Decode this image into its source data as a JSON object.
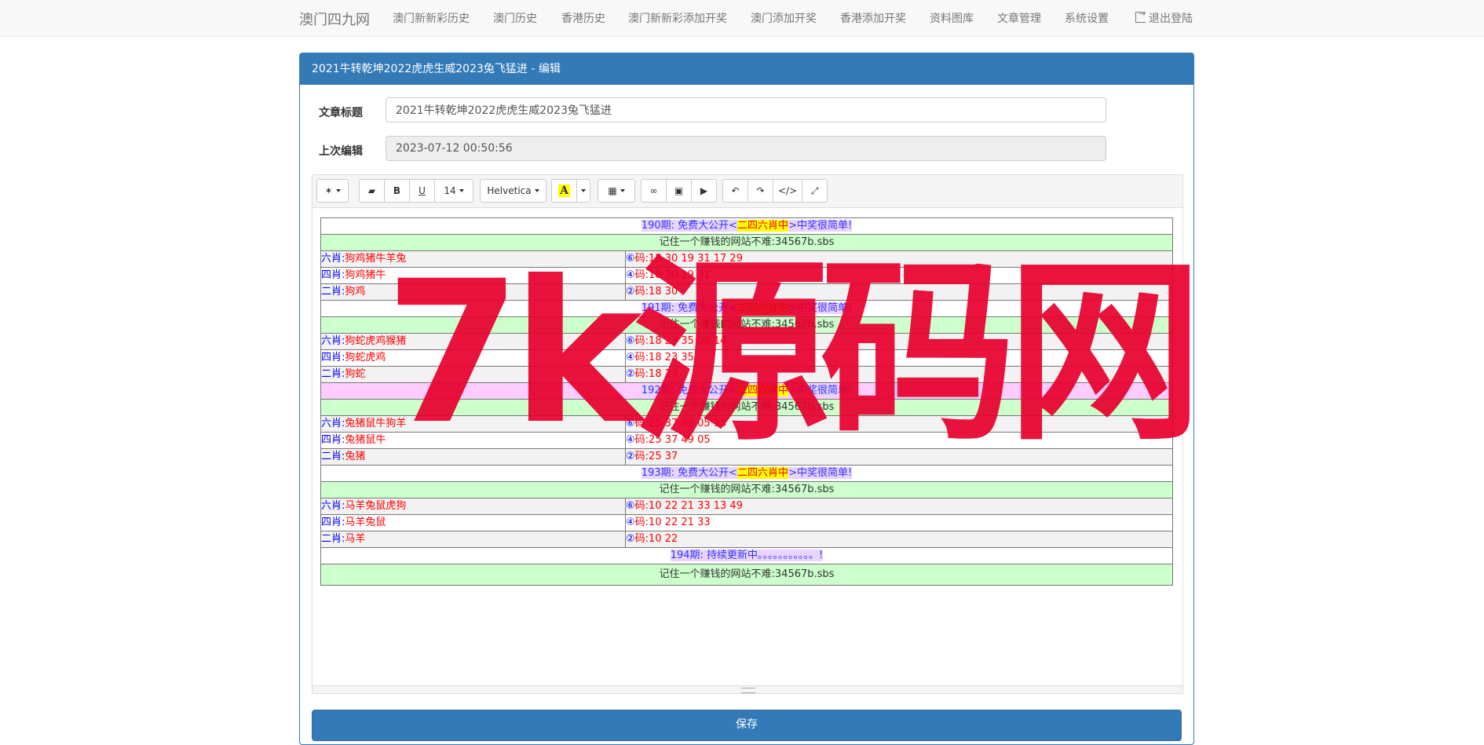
{
  "nav": {
    "brand": "澳门四九网",
    "links": [
      "澳门新新彩历史",
      "澳门历史",
      "香港历史",
      "澳门新新彩添加开奖",
      "澳门添加开奖",
      "香港添加开奖",
      "资料图库",
      "文章管理",
      "系统设置"
    ],
    "logout": "退出登陆"
  },
  "panel": {
    "title": "2021牛转乾坤2022虎虎生威2023兔飞猛进 - 编辑",
    "title_label": "文章标题",
    "title_value": "2021牛转乾坤2022虎虎生威2023兔飞猛进",
    "edited_label": "上次编辑",
    "edited_value": "2023-07-12 00:50:56",
    "save": "保存"
  },
  "toolbar": {
    "font_size": "14",
    "font_name": "Helvetica",
    "icons": [
      "magic-icon",
      "eraser-icon",
      "bold-icon",
      "underline-icon",
      "font-size-select",
      "font-name-select",
      "text-color-icon",
      "table-icon",
      "link-icon",
      "picture-icon",
      "video-icon",
      "undo-icon",
      "redo-icon",
      "code-icon",
      "fullscreen-icon"
    ],
    "bold": "B",
    "underline": "U",
    "color_a": "A",
    "code": "</>"
  },
  "content": {
    "blocks": [
      {
        "period": "190期:",
        "pre": " 免费大公开<",
        "highlight": "二四六肖中",
        "post": ">中奖很简单!",
        "notice": "记住一个赚钱的网站不难:34567b.sbs",
        "rows": [
          {
            "left_label": "六肖:",
            "left_value": "狗鸡猪牛羊兔",
            "circ": "⑥",
            "right_label": "码:",
            "right_value": "18 30 19 31 17 29"
          },
          {
            "left_label": "四肖:",
            "left_value": "狗鸡猪牛",
            "circ": "④",
            "right_label": "码:",
            "right_value": "18 30 19 31"
          },
          {
            "left_label": "二肖:",
            "left_value": "狗鸡",
            "circ": "②",
            "right_label": "码:",
            "right_value": "18 30"
          }
        ]
      },
      {
        "period": "191期:",
        "pre": " 免费大公开<",
        "highlight": "二四六肖中",
        "post": ">中奖很简单!",
        "notice": "记住一个赚钱的网站不难:34567b.sbs",
        "rows": [
          {
            "left_label": "六肖:",
            "left_value": "狗蛇虎鸡猴猪",
            "circ": "⑥",
            "right_label": "码:",
            "right_value": "18 23 35 06 14"
          },
          {
            "left_label": "四肖:",
            "left_value": "狗蛇虎鸡",
            "circ": "④",
            "right_label": "码:",
            "right_value": "18 23 35"
          },
          {
            "left_label": "二肖:",
            "left_value": "狗蛇",
            "circ": "②",
            "right_label": "码:",
            "right_value": "18 23"
          }
        ]
      },
      {
        "period": "192期:",
        "pre": " 免费大公开<",
        "highlight": "二四六肖中",
        "post": ">中奖很简单!",
        "notice": "记住一个赚钱的网站不难:34567b.sbs",
        "rows": [
          {
            "left_label": "六肖:",
            "left_value": "兔猪鼠牛狗羊",
            "circ": "⑥",
            "right_label": "码:",
            "right_value": "25 37 49 05 13"
          },
          {
            "left_label": "四肖:",
            "left_value": "兔猪鼠牛",
            "circ": "④",
            "right_label": "码:",
            "right_value": "25 37 49 05"
          },
          {
            "left_label": "二肖:",
            "left_value": "兔猪",
            "circ": "②",
            "right_label": "码:",
            "right_value": "25 37"
          }
        ]
      },
      {
        "period": "193期:",
        "pre": " 免费大公开<",
        "highlight": "二四六肖中",
        "post": ">中奖很简单!",
        "notice": "记住一个赚钱的网站不难:34567b.sbs",
        "rows": [
          {
            "left_label": "六肖:",
            "left_value": "马羊兔鼠虎狗",
            "circ": "⑥",
            "right_label": "码:",
            "right_value": "10 22 21 33 13 49"
          },
          {
            "left_label": "四肖:",
            "left_value": "马羊兔鼠",
            "circ": "④",
            "right_label": "码:",
            "right_value": "10 22 21 33"
          },
          {
            "left_label": "二肖:",
            "left_value": "马羊",
            "circ": "②",
            "right_label": "码:",
            "right_value": "10 22"
          }
        ]
      }
    ],
    "last_period": "194期:",
    "last_text": " 持续更新中。。。。。。。。。。。!",
    "last_notice": "记住一个赚钱的网站不难:34567b.sbs"
  },
  "watermark": "7k源码网"
}
